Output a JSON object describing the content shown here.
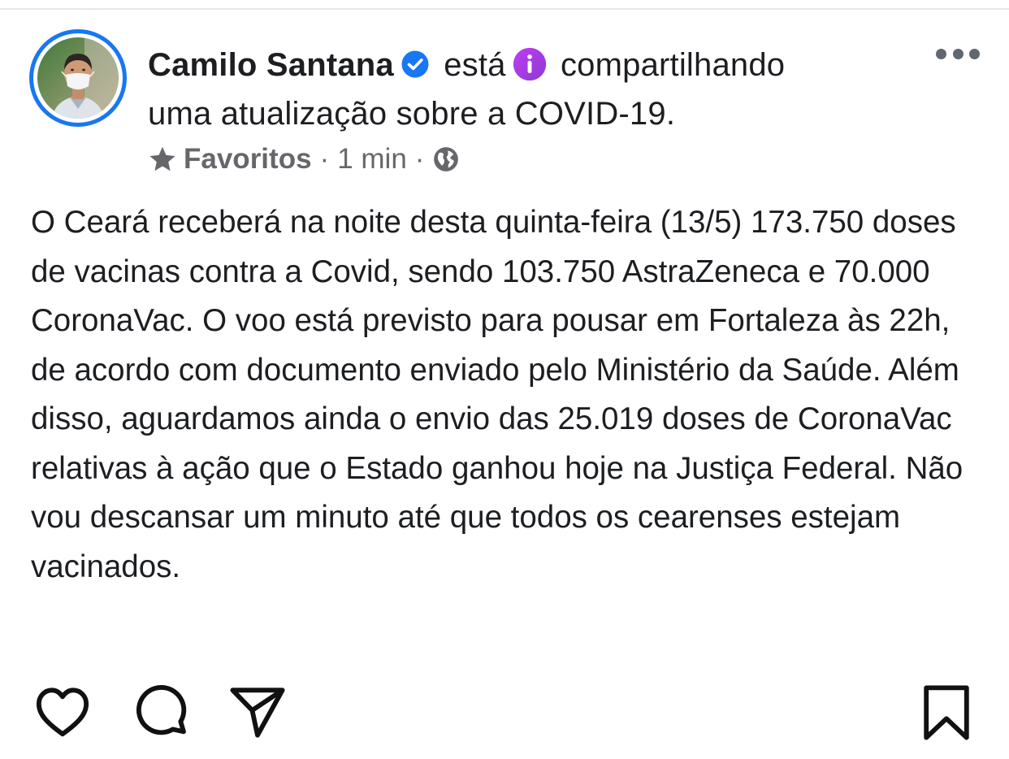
{
  "post": {
    "author": "Camilo Santana",
    "header_verb": "está",
    "header_action": "compartilhando",
    "header_rest": "uma atualização sobre a COVID-19.",
    "meta": {
      "group": "Favoritos",
      "separator": "·",
      "time": "1 min"
    },
    "body": "O Ceará receberá na noite desta quinta-feira (13/5) 173.750 doses de vacinas contra a Covid, sendo 103.750 AstraZeneca e 70.000 CoronaVac. O voo está previsto para pousar em Fortaleza às 22h, de acordo com documento enviado pelo Ministério da Saúde. Além disso, aguardamos ainda o envio das 25.019 doses de CoronaVac relativas à ação que o Estado ganhou hoje na Justiça Federal. Não vou descansar um minuto até que todos os cearenses estejam vacinados."
  },
  "icons": {
    "verified": "verified-badge-icon",
    "info": "info-icon",
    "star": "star-icon",
    "globe": "globe-icon",
    "more": "more-horizontal-icon",
    "like": "heart-icon",
    "comment": "comment-bubble-icon",
    "share": "paper-plane-icon",
    "save": "bookmark-icon"
  },
  "colors": {
    "verified_blue": "#1877f2",
    "info_purple": "#a33be0",
    "avatar_ring": "#1877f2",
    "meta_gray": "#65676b",
    "text": "#1c1e21"
  }
}
